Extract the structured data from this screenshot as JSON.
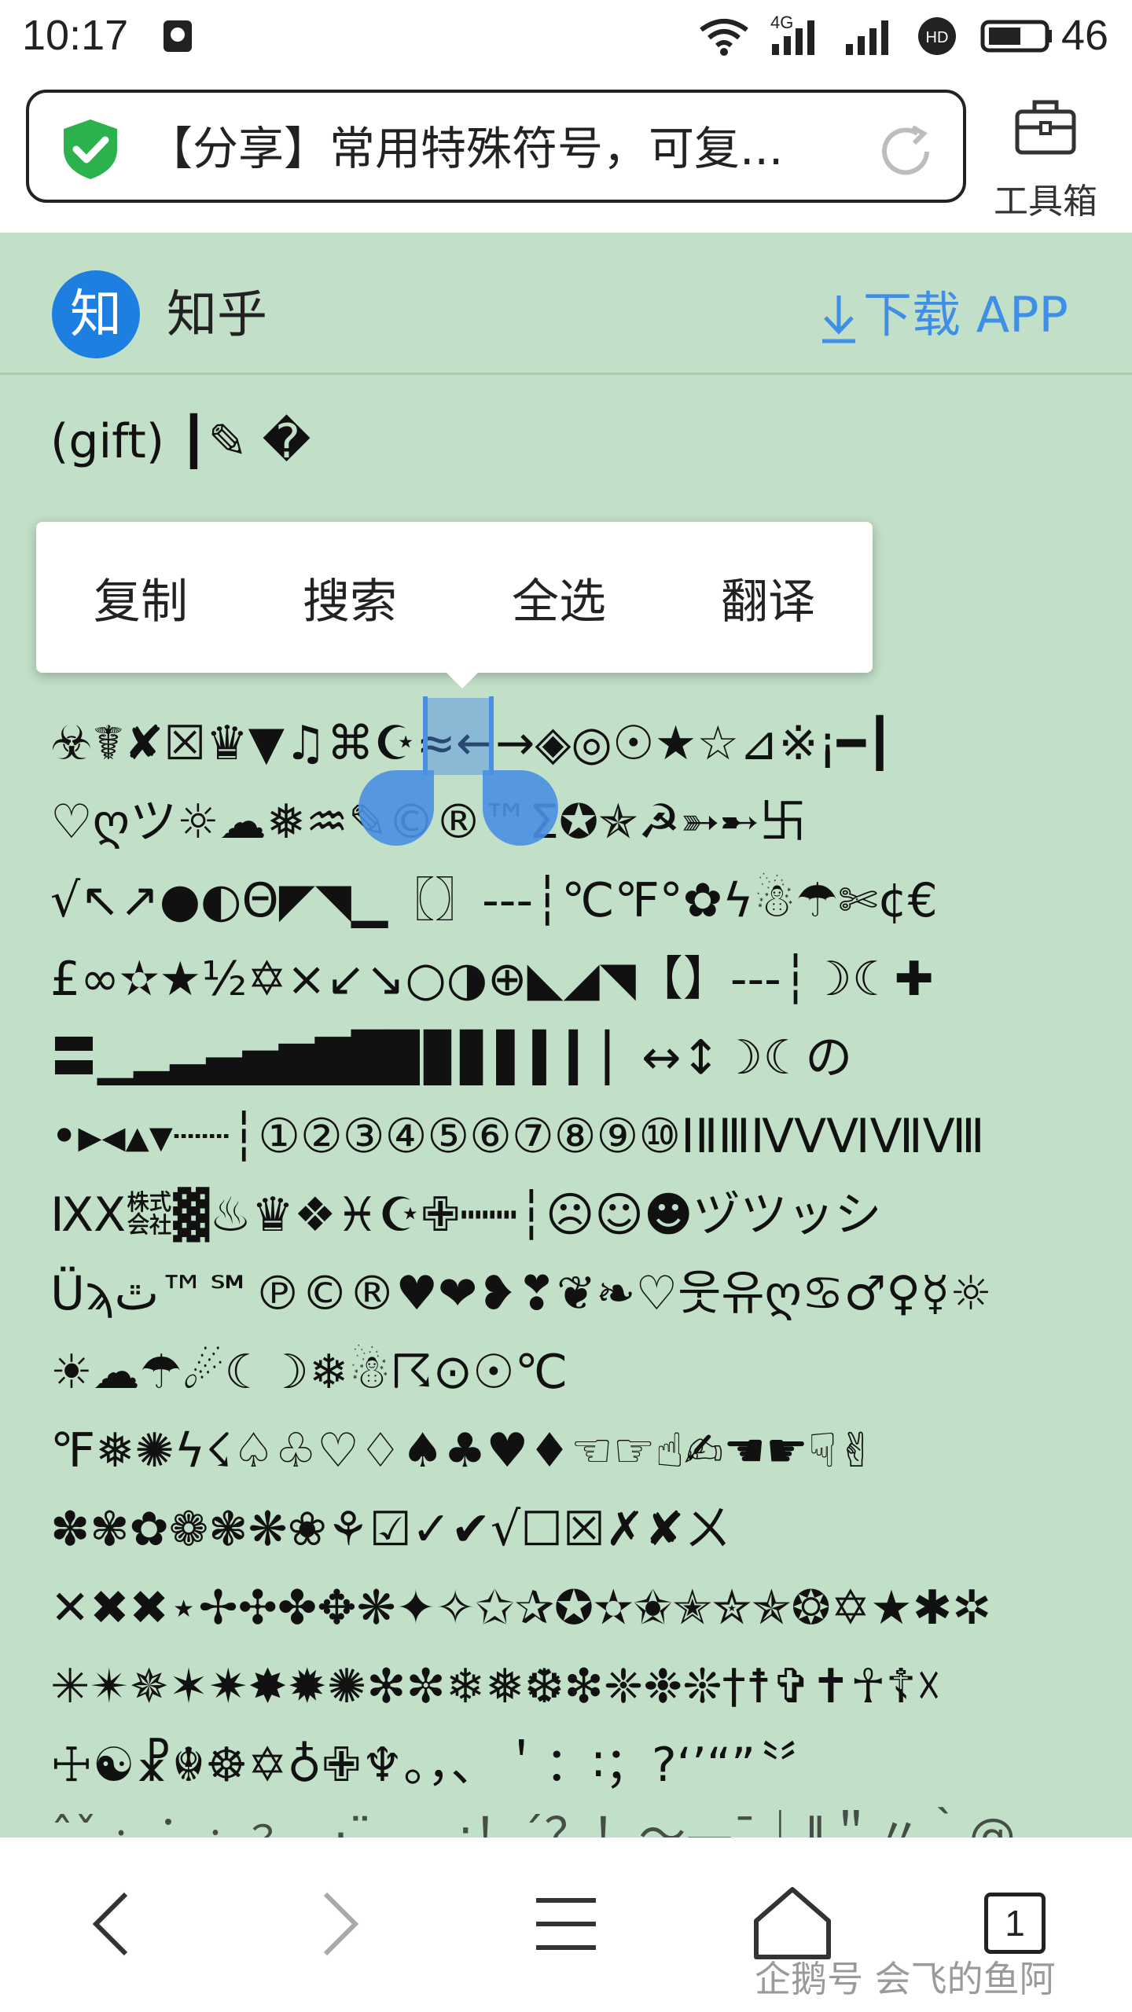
{
  "status_bar": {
    "time": "10:17",
    "network": "4G",
    "battery_level": "46"
  },
  "browser": {
    "address_text": "【分享】常用特殊符号，可复...",
    "toolbox_label": "工具箱"
  },
  "site_header": {
    "logo_char": "知",
    "site_name": "知乎",
    "download_label": "下载 APP"
  },
  "content_lines": [
    "(gift) ┃✎ �",
    "",
    "",
    "☣☤✘☒♛▼♫⌘☪≈←→◈◎☉★☆⊿※¡━┃",
    "♡ღツ☼☁❅♒✎©®™Σ✪✯☭➳➸卐",
    "√↖↗●◐Θ◤◥▁〖〗---┆℃℉°✿ϟ☃☂✄¢€",
    "£∞✫★½✡×↙↘○◑⊕◣◢◥【】---┆☽☾✚",
    "〓▁▂▃▄▅▆▇█▉▊▋▌▍▎▏↔↕☽☾の",
    "•▸◂▴▾┈┈┆①②③④⑤⑥⑦⑧⑨⑩ⅠⅡⅢⅣⅤⅥⅦⅧ",
    "ⅨⅩ㍿▓♨♛❖♓☪✙┉┉┆☹☺☻ヅツッシ",
    "Üϡﭢ™℠℗©®♥❤❥❣❦❧♡웃유ღ♋♂♀☿☼",
    "☀☁☂☄☾☽❄☃☈⊙☉℃",
    "℉❅✺ϟ☇♤♧♡♢♠♣♥♦☜☞☝✍☚☛☟✌",
    "✽✾✿❁❃❋❀⚘☑✓✔√☐☒✗✘ㄨ",
    "✕✖✖⋆✢✣✤✥❋✦✧✩✰✪✫✬✭✮✯❂✡★✱✲",
    "✳✴✵✶✷✸✹✺✻✼❄❅❆❇❈❉❊†☨✞✝☥☦☓",
    "☩☯☧☬☸✡♁✙♆。，、＇：∶；?‘’“”〝〞",
    "ˆˇ﹕︰﹔﹖﹑·¨….¸;！´？！～—ˉ｜‖＂〃｀@"
  ],
  "context_menu": {
    "items": [
      "复制",
      "搜索",
      "全选",
      "翻译"
    ]
  },
  "bottom_nav": {
    "tab_count": "1",
    "watermark": "企鹅号 会飞的鱼阿"
  },
  "colors": {
    "page_bg": "#c2dfc7",
    "accent_blue": "#3f8ee8",
    "zhihu_blue": "#1d7fe0",
    "shield_green": "#2bb24c"
  }
}
